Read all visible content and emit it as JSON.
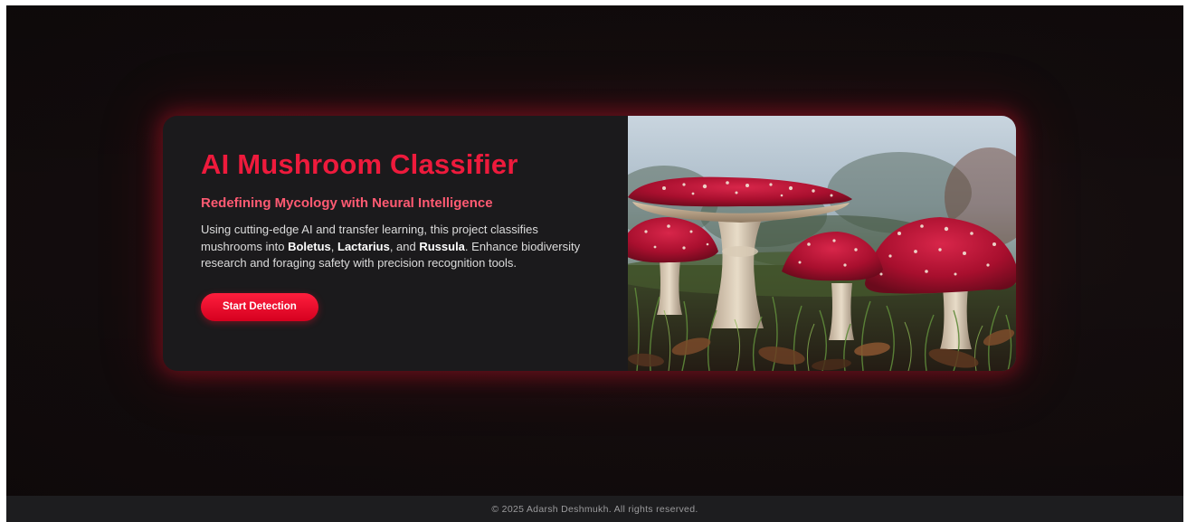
{
  "hero": {
    "title": "AI Mushroom Classifier",
    "subtitle": "Redefining Mycology with Neural Intelligence",
    "description": {
      "part1": "Using cutting-edge AI and transfer learning, this project classifies mushrooms into ",
      "class1": "Boletus",
      "sep1": ", ",
      "class2": "Lactarius",
      "sep2": ", and ",
      "class3": "Russula",
      "part2": ". Enhance biodiversity research and foraging safety with precision recognition tools."
    },
    "cta_label": "Start Detection"
  },
  "footer": {
    "copyright": "© 2025 Adarsh Deshmukh. All rights reserved."
  },
  "colors": {
    "accent": "#ee1a3c",
    "subtitle": "#ff5a72",
    "card_bg": "#1b1a1c",
    "page_bg": "#140d0e",
    "footer_bg": "#1d1d1f"
  },
  "image": {
    "subject": "mushroom-photo"
  }
}
